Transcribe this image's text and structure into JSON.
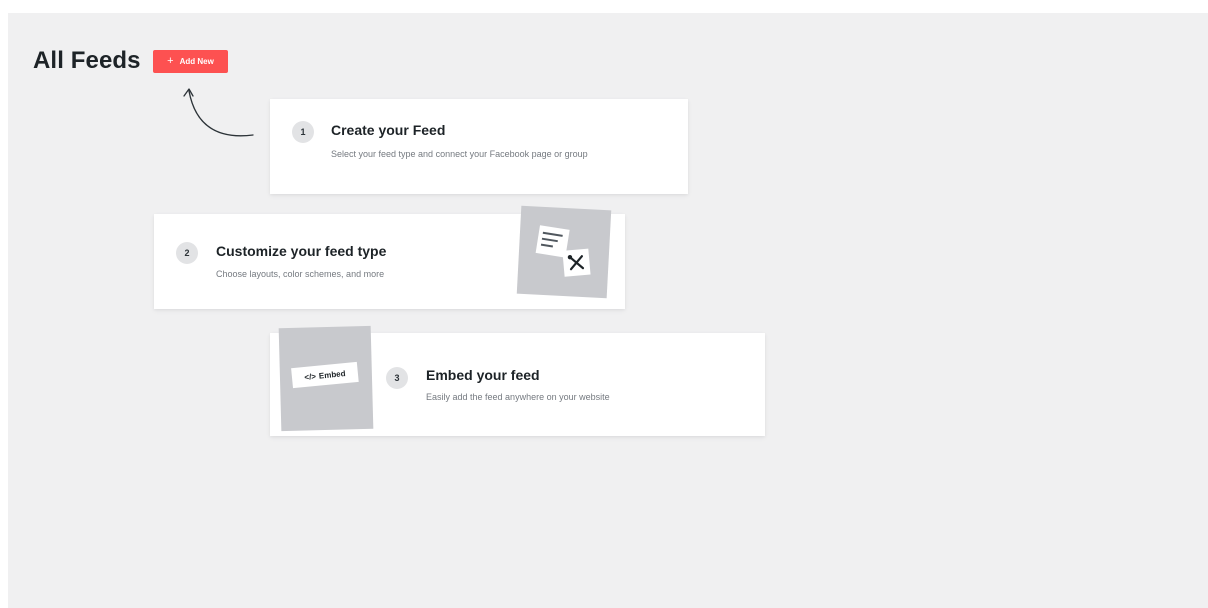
{
  "header": {
    "title": "All Feeds",
    "add_new_label": "Add New",
    "add_new_icon": "+"
  },
  "steps": [
    {
      "number": "1",
      "title": "Create your Feed",
      "description": "Select your feed type and connect your Facebook page or group"
    },
    {
      "number": "2",
      "title": "Customize your feed type",
      "description": "Choose layouts, color schemes, and more",
      "illustration": "customize-icon"
    },
    {
      "number": "3",
      "title": "Embed your feed",
      "description": "Easily add the feed anywhere on your website",
      "illustration": "embed-icon",
      "embed_code_symbol": "</>",
      "embed_label": "Embed"
    }
  ],
  "colors": {
    "accent": "#fd5151",
    "background": "#f0f0f1",
    "card": "#ffffff",
    "illustration_bg": "#c8c9cd"
  }
}
